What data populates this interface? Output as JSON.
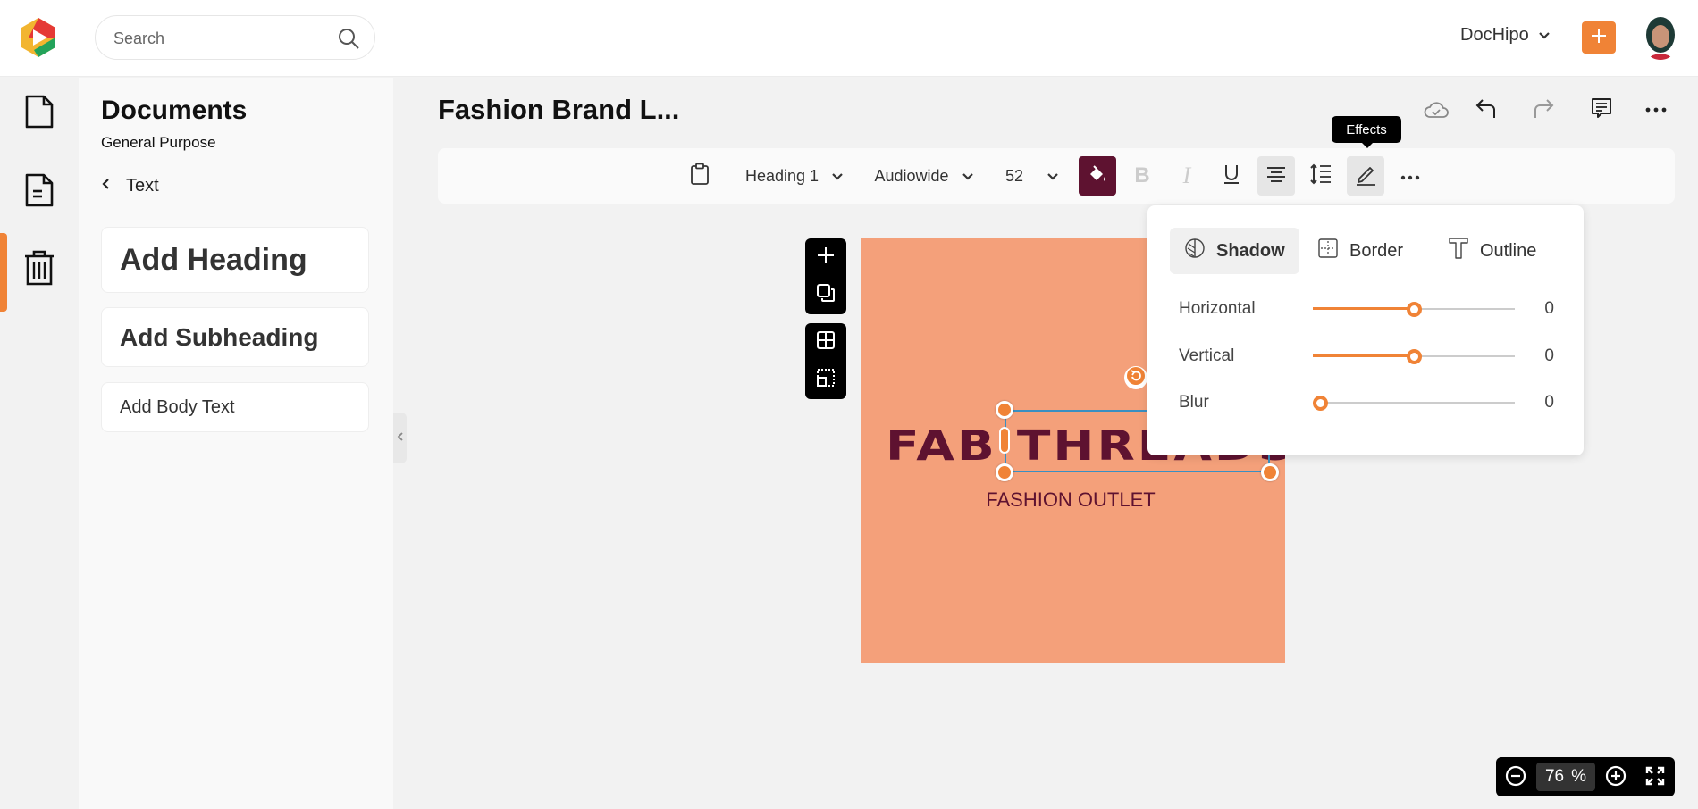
{
  "topbar": {
    "logo": "dochipo-logo",
    "search_placeholder": "Search",
    "search_icon": "search-icon",
    "workspace_label": "DocHipo",
    "create_icon": "plus-icon",
    "avatar": "user-avatar"
  },
  "rail": {
    "items": [
      {
        "name": "documents",
        "icon": "file-icon"
      },
      {
        "name": "templates",
        "icon": "file-text-icon",
        "active": true
      },
      {
        "name": "trash",
        "icon": "trash-icon"
      }
    ]
  },
  "panel": {
    "title": "Documents",
    "subtitle": "General Purpose",
    "back_label": "Text",
    "cards": {
      "heading": "Add Heading",
      "subheading": "Add Subheading",
      "body": "Add Body Text"
    }
  },
  "document": {
    "title": "Fashion Brand L..."
  },
  "toolbar": {
    "style": "Heading 1",
    "font": "Audiowide",
    "size": "52",
    "text_color": "#5e1230",
    "tooltip": "Effects"
  },
  "canvas": {
    "brand_text": "FAB THREADS",
    "tagline": "FASHION OUTLET",
    "background_color": "#f4a07a",
    "text_color": "#5e1230"
  },
  "effects": {
    "tabs": [
      {
        "label": "Shadow",
        "icon": "shadow-icon",
        "active": true
      },
      {
        "label": "Border",
        "icon": "border-icon"
      },
      {
        "label": "Outline",
        "icon": "outline-text-icon"
      }
    ],
    "sliders": [
      {
        "label": "Horizontal",
        "value": "0",
        "position": 0.5
      },
      {
        "label": "Vertical",
        "value": "0",
        "position": 0.5
      },
      {
        "label": "Blur",
        "value": "0",
        "position": 0.0
      }
    ]
  },
  "zoom": {
    "value": "76",
    "unit": "%"
  },
  "colors": {
    "accent": "#f08336",
    "selection": "#3a8fc1"
  }
}
